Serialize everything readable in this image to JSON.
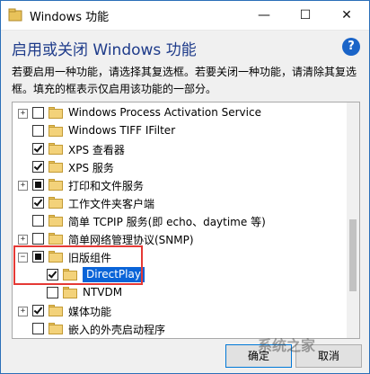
{
  "window": {
    "title": "Windows 功能",
    "controls": {
      "minimize": "—",
      "maximize": "☐",
      "close": "✕"
    }
  },
  "header": {
    "heading": "启用或关闭 Windows 功能",
    "help": "?",
    "description": "若要启用一种功能，请选择其复选框。若要关闭一种功能，请清除其复选框。填充的框表示仅启用该功能的一部分。"
  },
  "tree": {
    "items": [
      {
        "label": "Windows Process Activation Service",
        "expander": "+",
        "check": "none",
        "level": 0
      },
      {
        "label": "Windows TIFF IFilter",
        "expander": "",
        "check": "none",
        "level": 0
      },
      {
        "label": "XPS 查看器",
        "expander": "",
        "check": "checked",
        "level": 0
      },
      {
        "label": "XPS 服务",
        "expander": "",
        "check": "checked",
        "level": 0
      },
      {
        "label": "打印和文件服务",
        "expander": "+",
        "check": "partial",
        "level": 0
      },
      {
        "label": "工作文件夹客户端",
        "expander": "",
        "check": "checked",
        "level": 0
      },
      {
        "label": "简单 TCPIP 服务(即 echo、daytime 等)",
        "expander": "",
        "check": "none",
        "level": 0
      },
      {
        "label": "简单网络管理协议(SNMP)",
        "expander": "+",
        "check": "none",
        "level": 0
      },
      {
        "label": "旧版组件",
        "expander": "−",
        "check": "partial",
        "level": 0
      },
      {
        "label": "DirectPlay",
        "expander": "",
        "check": "checked",
        "level": 1,
        "selected": true
      },
      {
        "label": "NTVDM",
        "expander": "",
        "check": "none",
        "level": 1
      },
      {
        "label": "媒体功能",
        "expander": "+",
        "check": "checked",
        "level": 0
      },
      {
        "label": "嵌入的外壳启动程序",
        "expander": "",
        "check": "none",
        "level": 0
      }
    ]
  },
  "buttons": {
    "ok": "确定",
    "cancel": "取消"
  },
  "watermark": "系统之家",
  "colors": {
    "heading": "#1e3b8a",
    "selection": "#0a64d8",
    "highlight_box": "#e53935"
  }
}
